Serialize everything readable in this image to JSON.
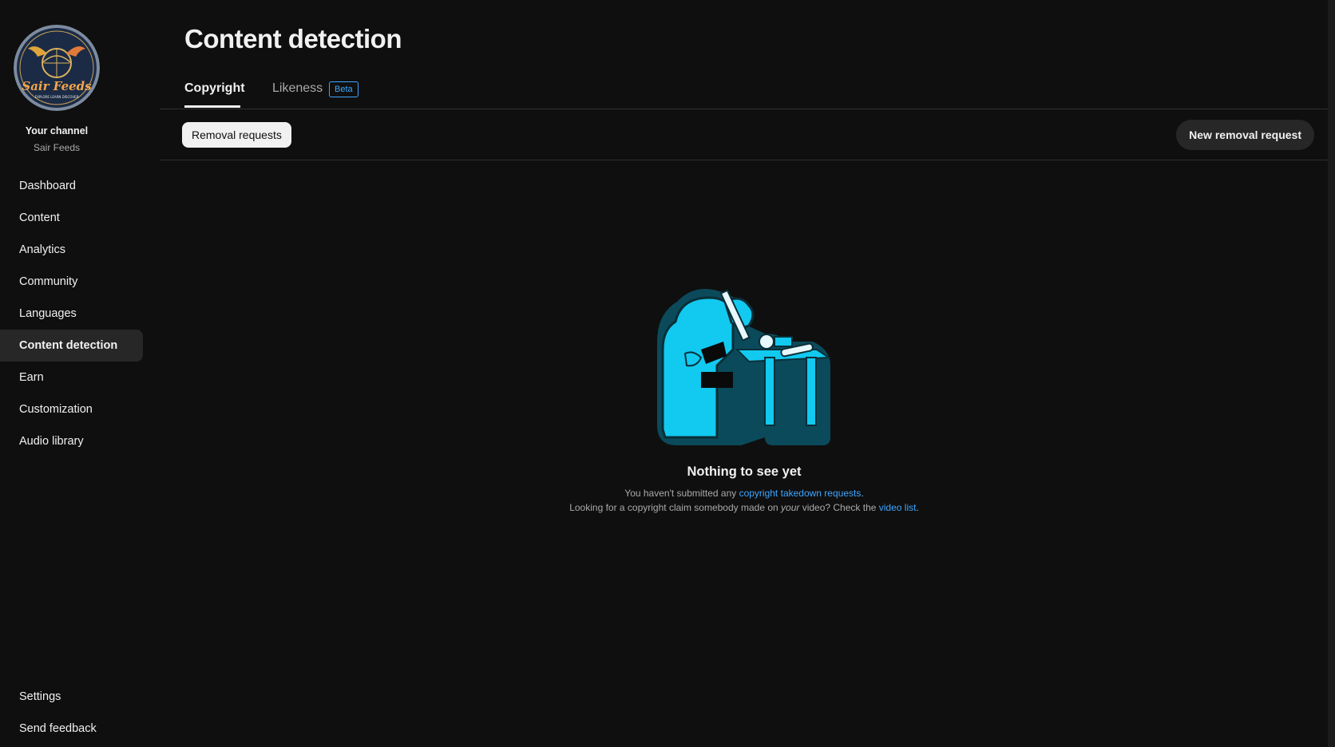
{
  "channel": {
    "title": "Your channel",
    "name": "Sair Feeds",
    "logo_text": "Sair Feeds",
    "logo_tagline": "EXPLORE LEARN DISCOVER"
  },
  "nav": {
    "items": [
      {
        "label": "Dashboard"
      },
      {
        "label": "Content"
      },
      {
        "label": "Analytics"
      },
      {
        "label": "Community"
      },
      {
        "label": "Languages"
      },
      {
        "label": "Content detection",
        "active": true
      },
      {
        "label": "Earn"
      },
      {
        "label": "Customization"
      },
      {
        "label": "Audio library"
      }
    ],
    "bottom": [
      {
        "label": "Settings"
      },
      {
        "label": "Send feedback"
      }
    ]
  },
  "page": {
    "title": "Content detection",
    "tabs": [
      {
        "label": "Copyright",
        "selected": true
      },
      {
        "label": "Likeness",
        "badge": "Beta"
      }
    ]
  },
  "toolbar": {
    "filter_chip": "Removal requests",
    "new_button": "New removal request"
  },
  "empty_state": {
    "title": "Nothing to see yet",
    "line1_prefix": "You haven't submitted any ",
    "line1_link": "copyright takedown requests",
    "line1_suffix": ".",
    "line2_prefix": "Looking for a copyright claim somebody made on ",
    "line2_emphasis": "your",
    "line2_middle": " video? Check the ",
    "line2_link": "video list",
    "line2_suffix": "."
  },
  "colors": {
    "background": "#0f0f0f",
    "link": "#3ea6ff",
    "illustration_main": "#12c9f0",
    "illustration_shadow": "#0b4a5a"
  }
}
